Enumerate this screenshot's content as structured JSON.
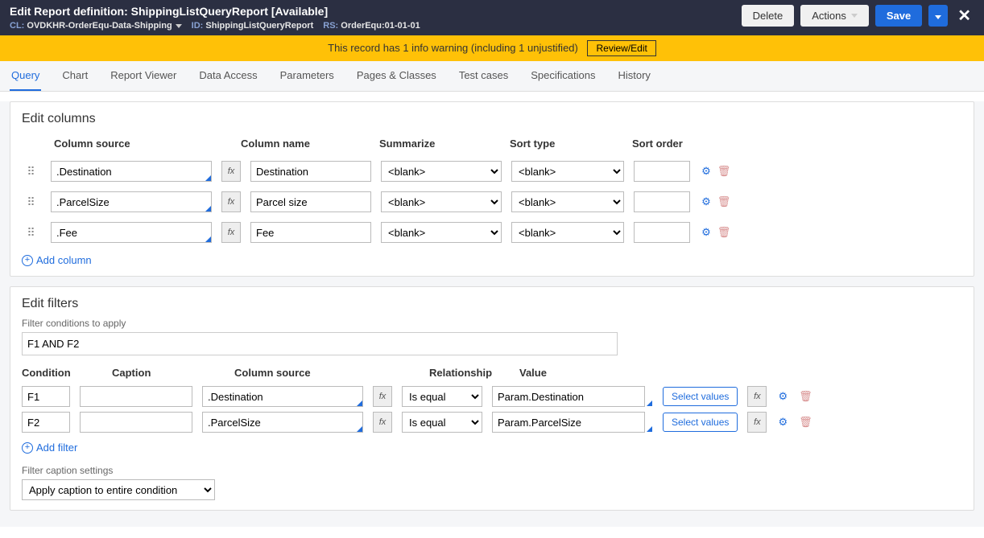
{
  "header": {
    "edit_label": "Edit",
    "title": "Report definition: ShippingListQueryReport [Available]",
    "cl_label": "CL:",
    "cl_value": "OVDKHR-OrderEqu-Data-Shipping",
    "id_label": "ID:",
    "id_value": "ShippingListQueryReport",
    "rs_label": "RS:",
    "rs_value": "OrderEqu:01-01-01",
    "delete_btn": "Delete",
    "actions_btn": "Actions",
    "save_btn": "Save"
  },
  "warning": {
    "text": "This record has 1 info warning (including 1 unjustified)",
    "review_btn": "Review/Edit"
  },
  "tabs": [
    "Query",
    "Chart",
    "Report Viewer",
    "Data Access",
    "Parameters",
    "Pages & Classes",
    "Test cases",
    "Specifications",
    "History"
  ],
  "columns_section": {
    "title": "Edit columns",
    "headers": {
      "source": "Column source",
      "name": "Column name",
      "summarize": "Summarize",
      "sort_type": "Sort type",
      "sort_order": "Sort order"
    },
    "blank_option": "<blank>",
    "add_label": "Add column",
    "rows": [
      {
        "source": ".Destination",
        "name": "Destination",
        "summarize": "<blank>",
        "sort_type": "<blank>",
        "sort_order": ""
      },
      {
        "source": ".ParcelSize",
        "name": "Parcel size",
        "summarize": "<blank>",
        "sort_type": "<blank>",
        "sort_order": ""
      },
      {
        "source": ".Fee",
        "name": "Fee",
        "summarize": "<blank>",
        "sort_type": "<blank>",
        "sort_order": ""
      }
    ]
  },
  "filters_section": {
    "title": "Edit filters",
    "conditions_label": "Filter conditions to apply",
    "conditions_value": "F1 AND F2",
    "headers": {
      "condition": "Condition",
      "caption": "Caption",
      "source": "Column source",
      "relationship": "Relationship",
      "value": "Value"
    },
    "select_values_btn": "Select values",
    "add_label": "Add filter",
    "rows": [
      {
        "condition": "F1",
        "caption": "",
        "source": ".Destination",
        "relationship": "Is equal",
        "value": "Param.Destination"
      },
      {
        "condition": "F2",
        "caption": "",
        "source": ".ParcelSize",
        "relationship": "Is equal",
        "value": "Param.ParcelSize"
      }
    ],
    "caption_settings_label": "Filter caption settings",
    "caption_settings_value": "Apply caption to entire condition"
  }
}
